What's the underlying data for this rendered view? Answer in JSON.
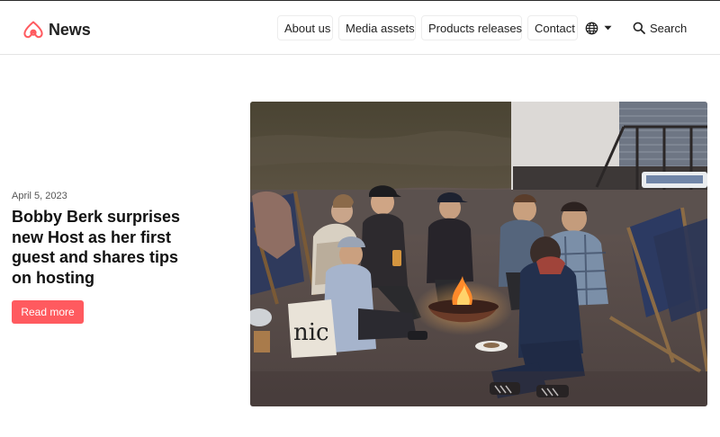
{
  "brand": {
    "name": "News",
    "logo": "airbnb-belo-icon",
    "color": "#ff5a5f"
  },
  "nav": {
    "items": [
      {
        "label": "About us"
      },
      {
        "label": "Media assets"
      },
      {
        "label": "Products releases"
      },
      {
        "label": "Contact"
      }
    ],
    "language_icon": "globe-icon",
    "language_caret": "caret-down-icon",
    "search": {
      "label": "Search",
      "icon": "search-icon"
    }
  },
  "article": {
    "date": "April 5, 2023",
    "title": "Bobby Berk surprises new Host as her first guest and shares tips on hosting",
    "cta_label": "Read more",
    "cta_color": "#ff5a5f"
  },
  "photo": {
    "alt": "Group of friends sitting around a fire pit on a beach at dusk"
  }
}
